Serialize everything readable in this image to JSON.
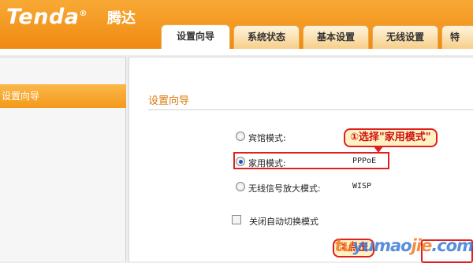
{
  "brand": {
    "logo": "Tenda",
    "logo_mark": "®",
    "name_cn": "腾达",
    "color": "#f39a1b"
  },
  "tabs": [
    {
      "label": "设置向导",
      "active": true
    },
    {
      "label": "系统状态",
      "active": false
    },
    {
      "label": "基本设置",
      "active": false
    },
    {
      "label": "无线设置",
      "active": false
    },
    {
      "label": "特",
      "active": false
    }
  ],
  "sidebar": {
    "items": [
      {
        "label": "设置向导",
        "active": true
      }
    ]
  },
  "main": {
    "title": "设置向导",
    "modes": [
      {
        "label": "宾馆模式:",
        "value": "",
        "selected": false
      },
      {
        "label": "家用模式:",
        "value": "PPPoE",
        "selected": true
      },
      {
        "label": "无线信号放大模式:",
        "value": "WISP",
        "selected": false
      }
    ],
    "auto_switch": {
      "label": "关闭自动切换模式",
      "checked": false
    }
  },
  "annotations": {
    "callout1": "①选择\"家用模式\"",
    "callout2": "②点击"
  },
  "watermark": {
    "part1": "tu",
    "part2": "yumao",
    "part3": "jie",
    "part4": ".com"
  }
}
